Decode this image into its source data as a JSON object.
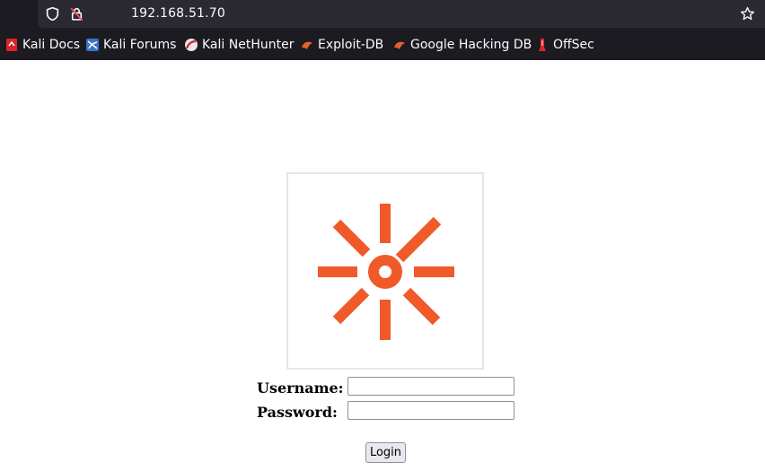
{
  "browser": {
    "url": "192.168.51.70",
    "bookmarks": [
      {
        "label": "Kali Docs",
        "icon": "kali-docs-icon"
      },
      {
        "label": "Kali Forums",
        "icon": "kali-forums-icon"
      },
      {
        "label": "Kali NetHunter",
        "icon": "kali-nethunter-icon"
      },
      {
        "label": "Exploit-DB",
        "icon": "exploit-db-icon"
      },
      {
        "label": "Google Hacking DB",
        "icon": "ghdb-icon"
      },
      {
        "label": "OffSec",
        "icon": "offsec-icon"
      }
    ]
  },
  "login": {
    "logo": "orange-sunburst-logo",
    "username_label": "Username:",
    "password_label": "Password:",
    "username_value": "",
    "password_value": "",
    "submit_label": "Login"
  },
  "colors": {
    "logo_orange": "#f05a28",
    "chrome_bg": "#1c1b22",
    "urlbar_bg": "#2b2a33"
  }
}
